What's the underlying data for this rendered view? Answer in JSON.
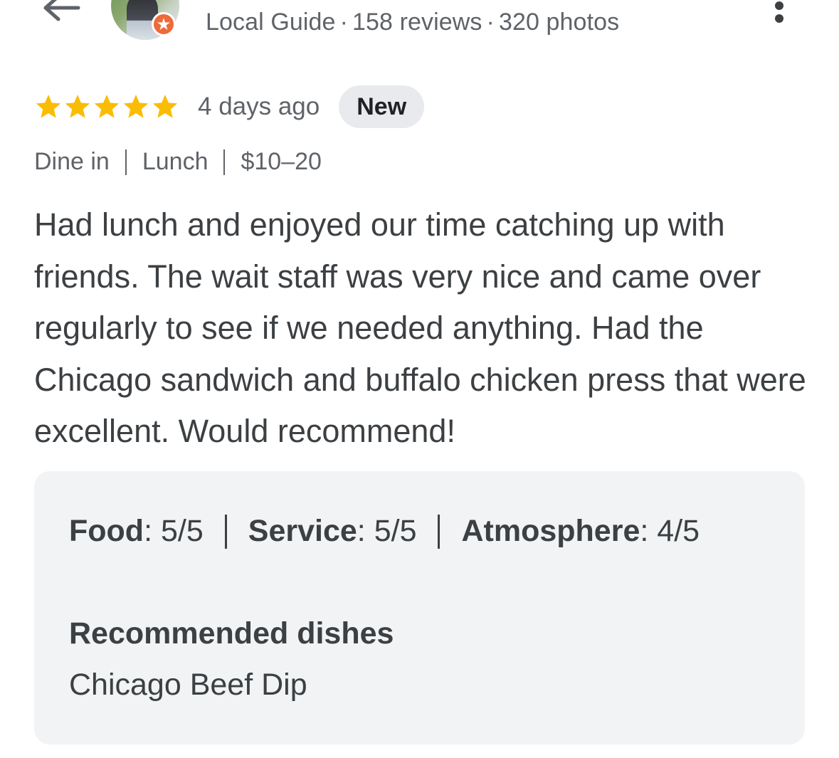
{
  "header": {
    "back_icon": "arrow-left-icon",
    "avatar_badge_icon": "local-guide-star-icon",
    "reviewer_level": "Local Guide",
    "review_count": "158 reviews",
    "photo_count": "320 photos",
    "separator": "·",
    "more_icon": "more-vert-icon"
  },
  "rating": {
    "stars": 5,
    "max_stars": 5,
    "star_color": "#fbbc04",
    "date": "4 days ago",
    "badge": "New"
  },
  "visit_tags": [
    "Dine in",
    "Lunch",
    "$10–20"
  ],
  "review": {
    "text": "Had lunch and enjoyed our time catching up with friends. The wait staff was very nice and came over regularly to see if we needed anything. Had the Chicago sandwich and buffalo chicken press that were excellent. Would recommend!"
  },
  "details": {
    "ratings": [
      {
        "label": "Food",
        "value": "5/5"
      },
      {
        "label": "Service",
        "value": "5/5"
      },
      {
        "label": "Atmosphere",
        "value": "4/5"
      }
    ],
    "recommended_title": "Recommended dishes",
    "recommended_dishes": "Chicago Beef Dip"
  },
  "colors": {
    "text_primary": "#3c4043",
    "text_secondary": "#5f6368",
    "chip_bg": "#e8eaed",
    "panel_bg": "#f1f3f4",
    "badge_orange": "#ee6a3a"
  }
}
